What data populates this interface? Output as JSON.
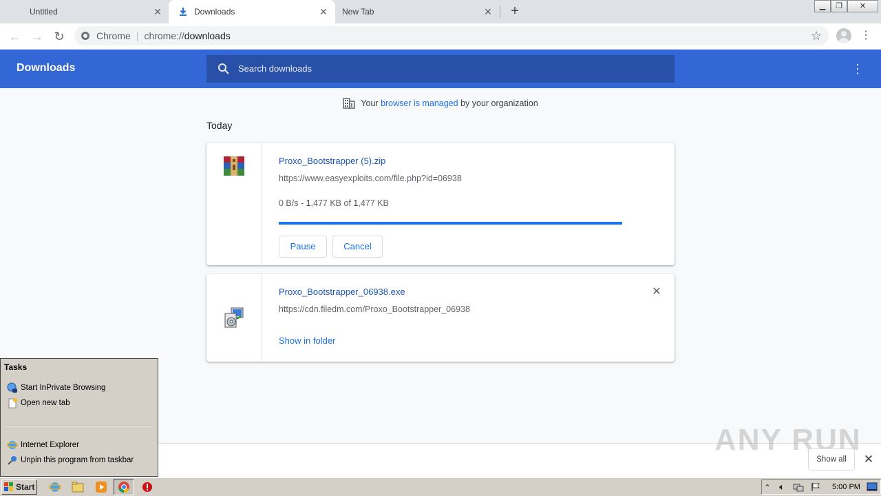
{
  "tabs": [
    {
      "title": "Untitled"
    },
    {
      "title": "Downloads"
    },
    {
      "title": "New Tab"
    }
  ],
  "omnibox": {
    "scheme_label": "Chrome",
    "url_prefix": "chrome://",
    "url_host": "downloads"
  },
  "downloads_page": {
    "title": "Downloads",
    "search_placeholder": "Search downloads",
    "managed_pre": "Your ",
    "managed_link": "browser is managed",
    "managed_post": " by your organization",
    "date_header": "Today"
  },
  "downloads": [
    {
      "name": "Proxo_Bootstrapper (5).zip",
      "url": "https://www.easyexploits.com/file.php?id=06938",
      "status_rate": "0 B/s - ",
      "status_done_int": "1",
      "status_done_rest": ",477 KB of ",
      "status_total_int": "1",
      "status_total_rest": ",477 KB",
      "progress": 1.0,
      "pause_label": "Pause",
      "cancel_label": "Cancel",
      "icon": "winrar-archive-icon"
    },
    {
      "name": "Proxo_Bootstrapper_06938.exe",
      "url": "https://cdn.filedm.com/Proxo_Bootstrapper_06938",
      "show_in_folder_label": "Show in folder",
      "icon": "installer-icon"
    }
  ],
  "shelf": {
    "show_all_label": "Show all",
    "watermark": "ANY RUN"
  },
  "jumplist": {
    "title": "Tasks",
    "items": [
      {
        "label": "Start InPrivate Browsing",
        "icon": "inprivate-icon"
      },
      {
        "label": "Open new tab",
        "icon": "new-tab-icon"
      },
      {
        "label": "Internet Explorer",
        "icon": "ie-icon"
      },
      {
        "label": "Unpin this program from taskbar",
        "icon": "unpin-icon"
      }
    ]
  },
  "taskbar": {
    "start_label": "Start",
    "clock": "5:00 PM"
  },
  "colors": {
    "header_blue": "#3367d6",
    "search_bg": "#2850a8",
    "link_blue": "#1a73e8",
    "progress_blue": "#1a73e8"
  }
}
